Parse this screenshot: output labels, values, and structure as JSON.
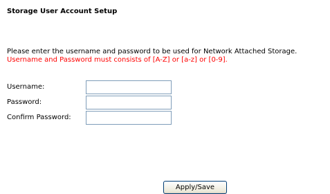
{
  "page": {
    "title": "Storage User Account Setup",
    "description": "Please enter the username and password to be used for Network Attached Storage.",
    "warning": "Username and Password must consists of [A-Z] or [a-z] or [0-9]."
  },
  "form": {
    "username": {
      "label": "Username:",
      "value": ""
    },
    "password": {
      "label": "Password:",
      "value": ""
    },
    "confirm_password": {
      "label": "Confirm Password:",
      "value": ""
    }
  },
  "actions": {
    "apply_save_label": "Apply/Save"
  },
  "colors": {
    "warning_text": "#ff0000",
    "input_border": "#7f9db9",
    "button_border": "#003c74"
  }
}
